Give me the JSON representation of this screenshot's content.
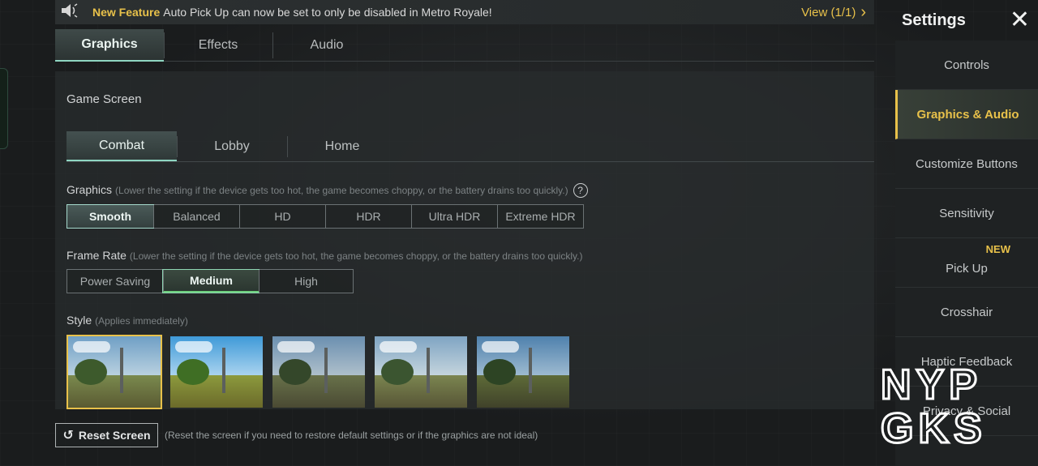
{
  "notice": {
    "speaker_icon": "speaker-icon",
    "highlight": "New Feature",
    "message": "Auto Pick Up can now be set to only be disabled in Metro Royale!",
    "view_label": "View (1/1)",
    "view_chevron": "›"
  },
  "tabs": [
    {
      "label": "Graphics",
      "active": true
    },
    {
      "label": "Effects",
      "active": false
    },
    {
      "label": "Audio",
      "active": false
    }
  ],
  "game_screen": {
    "title": "Game Screen",
    "sub_tabs": [
      {
        "label": "Combat",
        "active": true
      },
      {
        "label": "Lobby",
        "active": false
      },
      {
        "label": "Home",
        "active": false
      }
    ]
  },
  "graphics": {
    "label": "Graphics",
    "hint": "(Lower the setting if the device gets too hot, the game becomes choppy, or the battery drains too quickly.)",
    "help_icon": "?",
    "options": [
      "Smooth",
      "Balanced",
      "HD",
      "HDR",
      "Ultra HDR",
      "Extreme HDR"
    ],
    "selected": "Smooth"
  },
  "frame_rate": {
    "label": "Frame Rate",
    "hint": "(Lower the setting if the device gets too hot, the game becomes choppy, or the battery drains too quickly.)",
    "options": [
      "Power Saving",
      "Medium",
      "High"
    ],
    "selected": "Medium"
  },
  "style": {
    "label": "Style",
    "hint": "(Applies immediately)",
    "selected_index": 0,
    "count": 5
  },
  "reset": {
    "icon": "↺",
    "label": "Reset Screen",
    "description": "(Reset the screen if you need to restore default settings or if the graphics are not ideal)"
  },
  "sidebar": {
    "title": "Settings",
    "close": "✕",
    "items": [
      {
        "label": "Controls",
        "active": false
      },
      {
        "label": "Graphics & Audio",
        "active": true
      },
      {
        "label": "Customize Buttons",
        "active": false
      },
      {
        "label": "Sensitivity",
        "active": false
      },
      {
        "label": "Pick Up",
        "active": false,
        "badge": "NEW"
      },
      {
        "label": "Crosshair",
        "active": false
      },
      {
        "label": "Haptic Feedback",
        "active": false
      },
      {
        "label": "Privacy & Social",
        "active": false
      }
    ]
  },
  "watermark": {
    "line1": "NYP",
    "line2": "GKS"
  },
  "colors": {
    "accent": "#e8c14a",
    "teal": "#8fd6c2",
    "green": "#6fd07e"
  }
}
